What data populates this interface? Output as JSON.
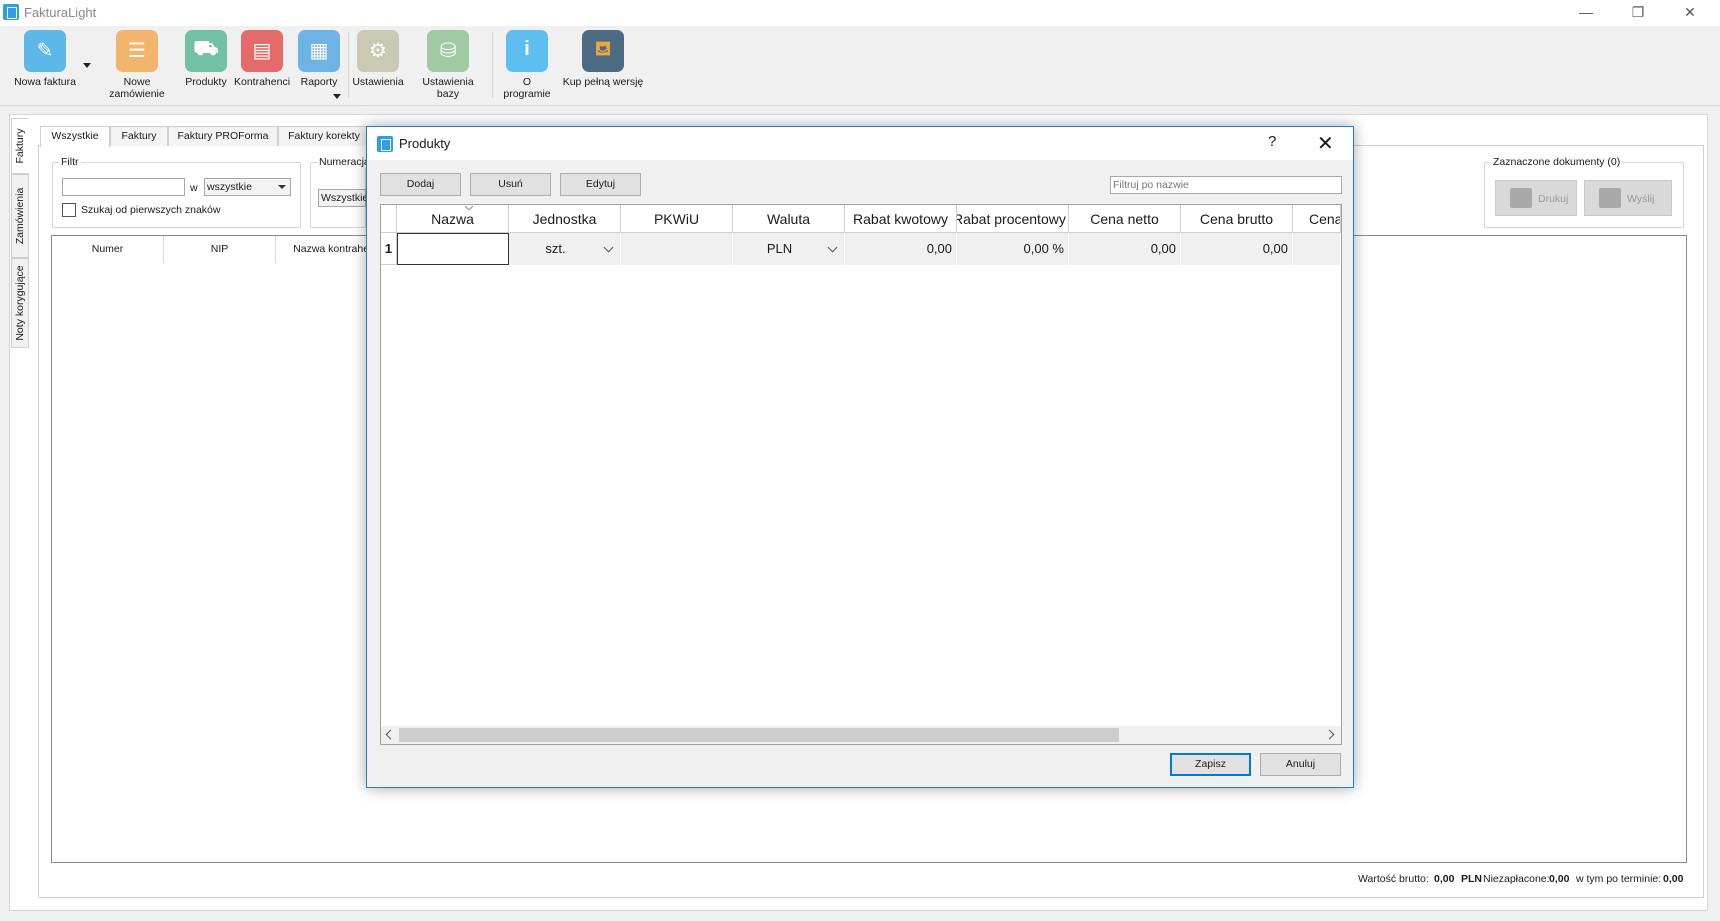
{
  "window": {
    "title": "FakturaLight",
    "minimize": "—",
    "restore": "❐",
    "close": "✕"
  },
  "toolbar": {
    "items": [
      {
        "label": "Nowa faktura",
        "icon": "new-invoice-icon",
        "color": "#5db7e8"
      },
      {
        "label": "Nowe zamówienie",
        "icon": "new-order-icon",
        "color": "#f2b56b"
      },
      {
        "label": "Produkty",
        "icon": "products-icon",
        "color": "#73c1a4"
      },
      {
        "label": "Kontrahenci",
        "icon": "contractors-icon",
        "color": "#e56b6b"
      },
      {
        "label": "Raporty",
        "icon": "reports-icon",
        "color": "#6fb3e6"
      },
      {
        "label": "Ustawienia",
        "icon": "settings-icon",
        "color": "#c9c9b4"
      },
      {
        "label": "Ustawienia bazy",
        "icon": "database-settings-icon",
        "color": "#9fcaa3"
      },
      {
        "label": "O programie",
        "icon": "info-icon",
        "color": "#5fbef0"
      },
      {
        "label": "Kup pełną wersję",
        "icon": "basket-icon",
        "color": "#4b6b85"
      }
    ]
  },
  "side_tabs": [
    "Faktury",
    "Zamówienia",
    "Noty korygujące"
  ],
  "doc_tabs": [
    "Wszystkie",
    "Faktury",
    "Faktury PROForma",
    "Faktury korekty"
  ],
  "filter": {
    "legend": "Filtr",
    "input_value": "",
    "in_label": "w",
    "scope": "wszystkie",
    "prefix_checkbox_label": "Szukaj od pierwszych znaków",
    "prefix_checked": false
  },
  "numbering": {
    "legend": "Numeracja",
    "value": "Wszystkie"
  },
  "list_columns": [
    "Numer",
    "NIP",
    "Nazwa kontrahent"
  ],
  "selected_docs": {
    "legend": "Zaznaczone dokumenty (0)",
    "print_label": "Drukuj",
    "send_label": "Wyślij"
  },
  "status": {
    "gross_label": "Wartość brutto:",
    "gross_value": "0,00",
    "currency": "PLN",
    "unpaid_label": "Niezapłacone:",
    "unpaid_value": "0,00",
    "overdue_label": "w tym po terminie:",
    "overdue_value": "0,00"
  },
  "dialog": {
    "title": "Produkty",
    "help": "?",
    "close": "✕",
    "add_label": "Dodaj",
    "remove_label": "Usuń",
    "edit_label": "Edytuj",
    "filter_placeholder": "Filtruj po nazwie",
    "columns": [
      "Nazwa",
      "Jednostka",
      "PKWiU",
      "Waluta",
      "Rabat kwotowy",
      "Rabat procentowy",
      "Cena netto",
      "Cena brutto",
      "Cena"
    ],
    "rows": [
      {
        "index": "1",
        "name": "",
        "unit": "szt.",
        "pkwiu": "",
        "currency": "PLN",
        "discount_amount": "0,00",
        "discount_percent": "0,00 %",
        "net_price": "0,00",
        "gross_price": "0,00",
        "price": ""
      }
    ],
    "save_label": "Zapisz",
    "cancel_label": "Anuluj"
  }
}
